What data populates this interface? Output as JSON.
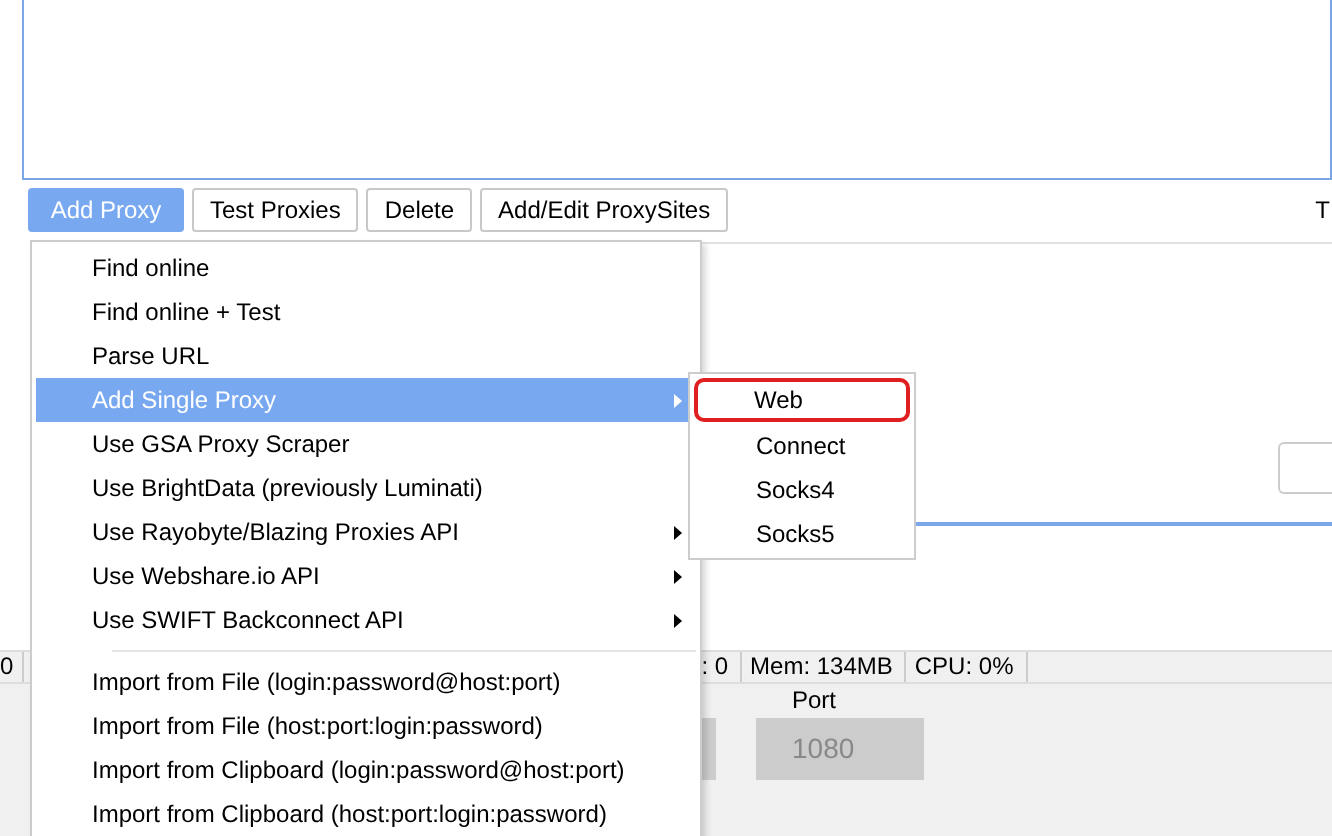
{
  "toolbar": {
    "buttons": [
      {
        "label": "Add Proxy",
        "selected": true
      },
      {
        "label": "Test Proxies",
        "selected": false
      },
      {
        "label": "Delete",
        "selected": false
      },
      {
        "label": "Add/Edit ProxySites",
        "selected": false
      }
    ]
  },
  "edge_text": "T",
  "status_bar": {
    "cells": [
      "0",
      ": 0",
      "Mem: 134MB",
      "CPU: 0%"
    ]
  },
  "port": {
    "label": "Port",
    "value": "1080"
  },
  "menu": {
    "items": [
      {
        "kind": "item",
        "label": "Find online",
        "selected": false,
        "submenu": false
      },
      {
        "kind": "item",
        "label": "Find online + Test",
        "selected": false,
        "submenu": false
      },
      {
        "kind": "item",
        "label": "Parse URL",
        "selected": false,
        "submenu": false
      },
      {
        "kind": "item",
        "label": "Add Single Proxy",
        "selected": true,
        "submenu": true
      },
      {
        "kind": "item",
        "label": "Use GSA Proxy Scraper",
        "selected": false,
        "submenu": false
      },
      {
        "kind": "item",
        "label": "Use BrightData (previously Luminati)",
        "selected": false,
        "submenu": false
      },
      {
        "kind": "item",
        "label": "Use Rayobyte/Blazing Proxies API",
        "selected": false,
        "submenu": true
      },
      {
        "kind": "item",
        "label": "Use Webshare.io API",
        "selected": false,
        "submenu": true
      },
      {
        "kind": "item",
        "label": "Use SWIFT Backconnect API",
        "selected": false,
        "submenu": true
      },
      {
        "kind": "separator"
      },
      {
        "kind": "item",
        "label": "Import from File (login:password@host:port)",
        "selected": false,
        "submenu": false
      },
      {
        "kind": "item",
        "label": "Import from File (host:port:login:password)",
        "selected": false,
        "submenu": false
      },
      {
        "kind": "item",
        "label": "Import from Clipboard (login:password@host:port)",
        "selected": false,
        "submenu": false
      },
      {
        "kind": "item",
        "label": "Import from Clipboard (host:port:login:password)",
        "selected": false,
        "submenu": false
      }
    ]
  },
  "submenu": {
    "items": [
      {
        "label": "Web",
        "outlined": true
      },
      {
        "label": "Connect",
        "outlined": false
      },
      {
        "label": "Socks4",
        "outlined": false
      },
      {
        "label": "Socks5",
        "outlined": false
      }
    ]
  }
}
